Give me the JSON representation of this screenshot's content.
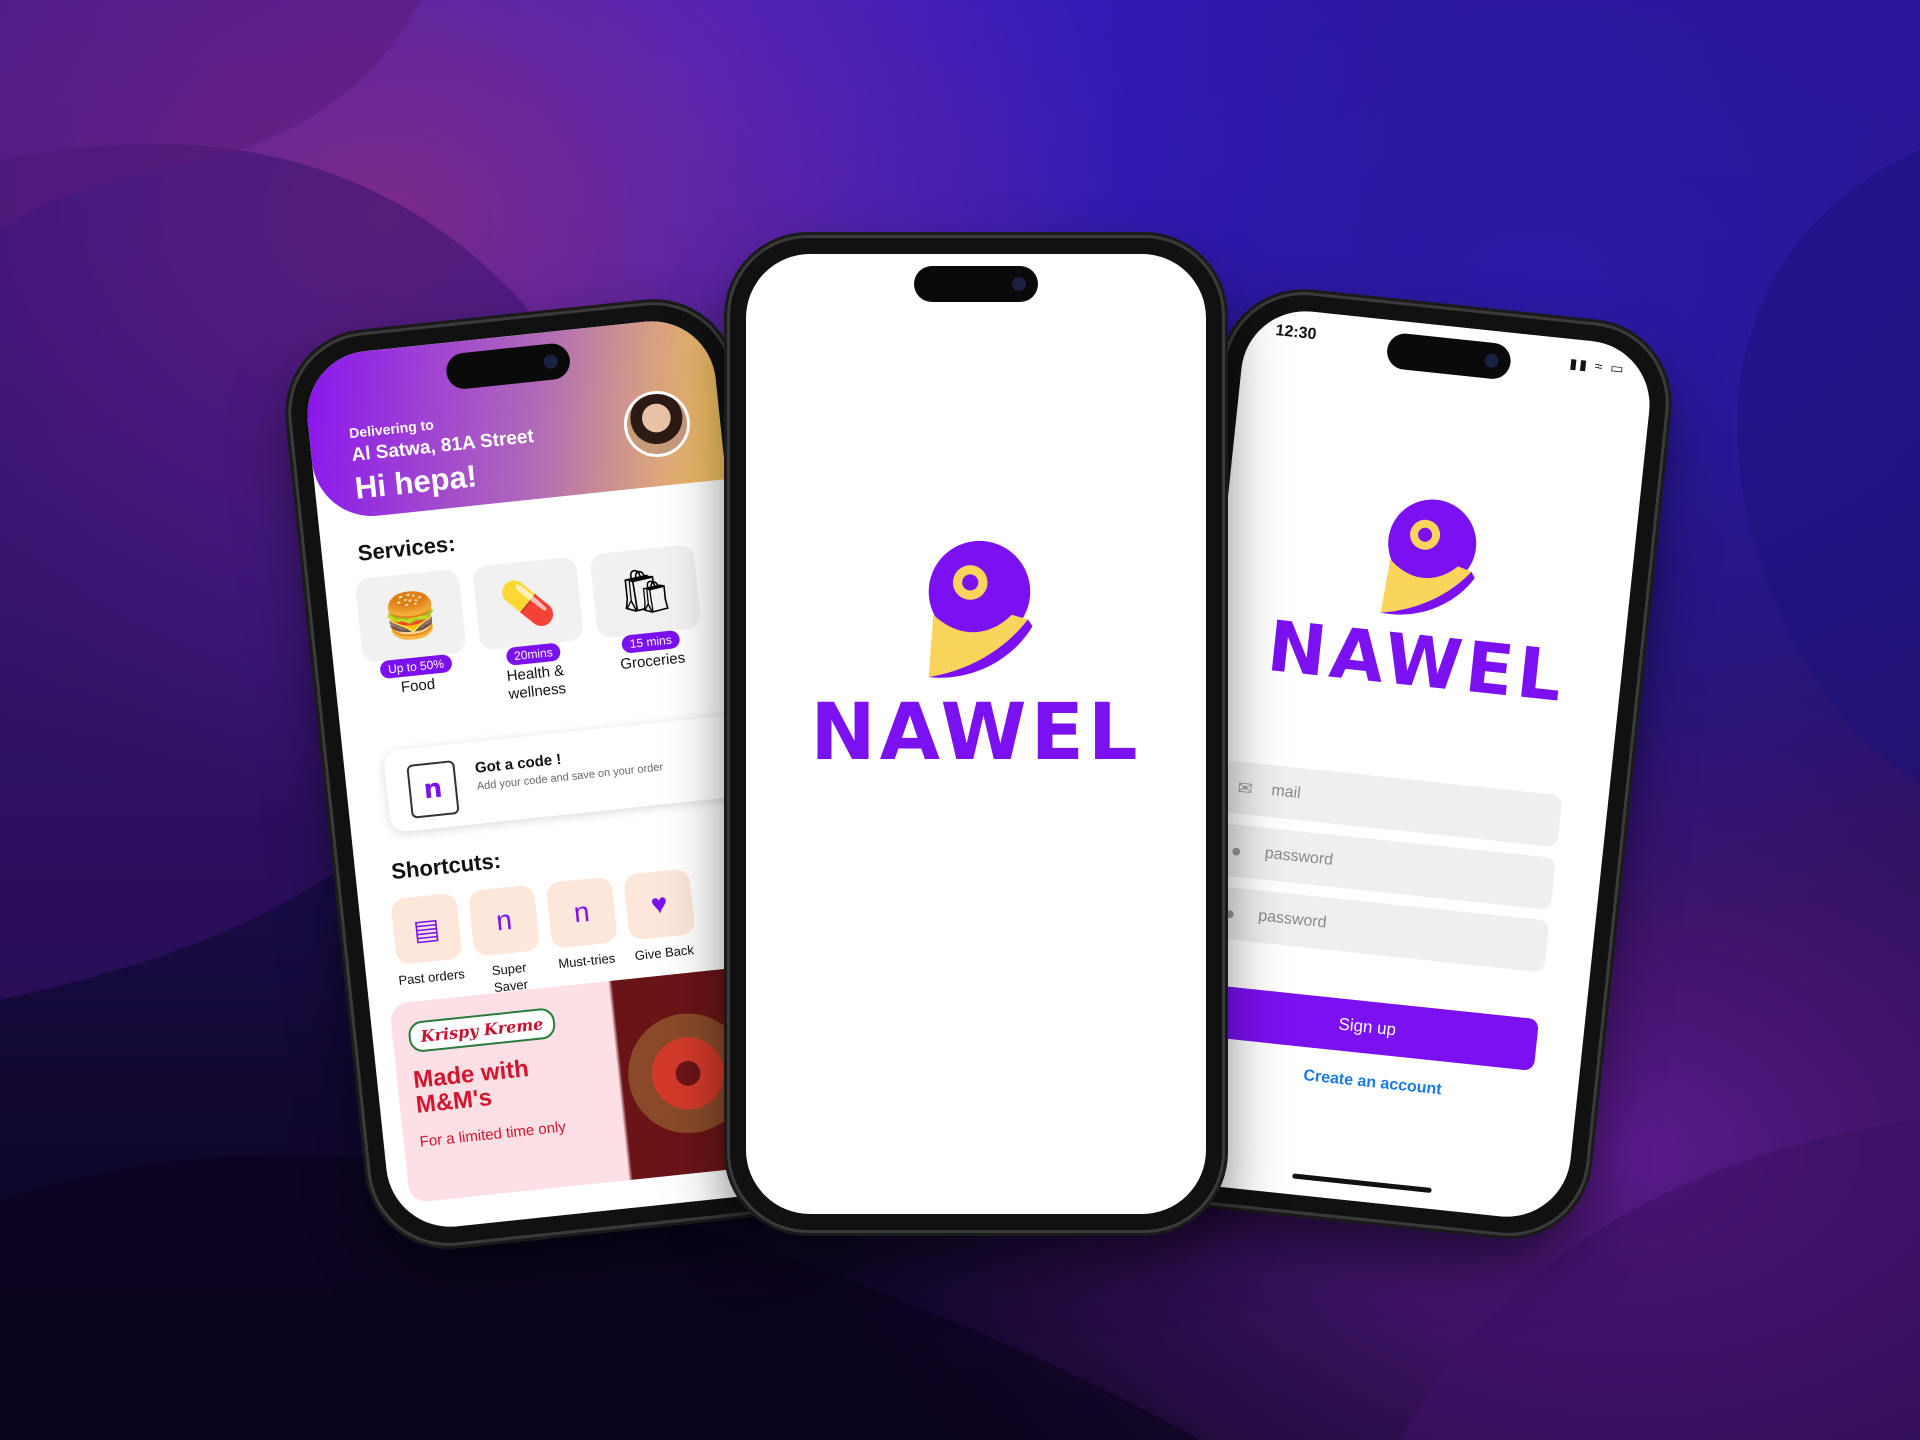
{
  "brand": {
    "name": "NAWEL",
    "purple": "#7b10f0",
    "yellow": "#f8d55a"
  },
  "home": {
    "delivering_to_label": "Delivering to",
    "address": "Al Satwa, 81A Street",
    "greeting": "Hi hepa!",
    "services_title": "Services:",
    "services": [
      {
        "label": "Food",
        "badge": "Up to 50%",
        "icon": "burger-icon"
      },
      {
        "label": "Health & wellness",
        "badge": "20mins",
        "icon": "pharmacy-icon"
      },
      {
        "label": "Groceries",
        "badge": "15 mins",
        "icon": "grocery-bag-icon"
      }
    ],
    "code_card": {
      "title": "Got a code !",
      "subtitle": "Add your code and save on your order"
    },
    "shortcuts_title": "Shortcuts:",
    "shortcuts": [
      {
        "label": "Past orders",
        "icon": "receipt-icon"
      },
      {
        "label": "Super Saver",
        "icon": "saver-tag-icon"
      },
      {
        "label": "Must-tries",
        "icon": "sparkle-n-icon"
      },
      {
        "label": "Give Back",
        "icon": "heart-hands-icon"
      }
    ],
    "promo": {
      "brand": "Krispy Kreme",
      "headline": "Made with M&M's",
      "subtitle": "For a limited time only"
    }
  },
  "login": {
    "status_time": "12:30",
    "status_icons": "signal-wifi-battery",
    "mail_placeholder": "mail",
    "password_placeholder": "password",
    "confirm_placeholder": "password",
    "signup_label": "Sign up",
    "create_account_label": "Create an account"
  }
}
